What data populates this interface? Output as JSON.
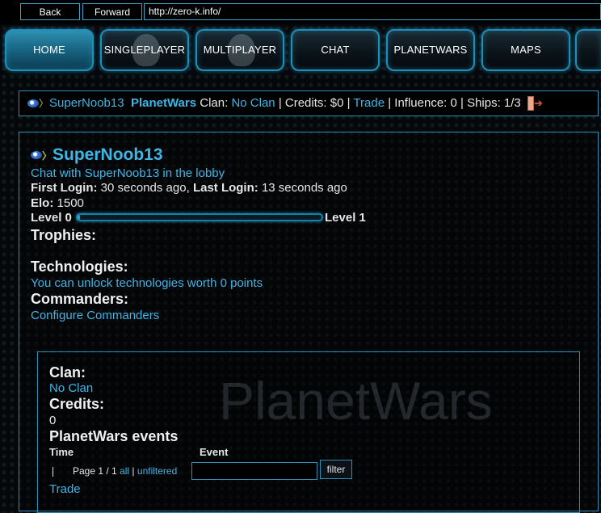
{
  "browser": {
    "back_label": "Back",
    "forward_label": "Forward",
    "url": "http://zero-k.info/"
  },
  "menu": {
    "items": [
      {
        "label": "HOME",
        "active": true
      },
      {
        "label": "SINGLEPLAYER",
        "icon": "single-player-silhouette-icon"
      },
      {
        "label": "MULTIPLAYER",
        "icon": "multi-player-silhouette-icon"
      },
      {
        "label": "CHAT"
      },
      {
        "label": "PLANETWARS"
      },
      {
        "label": "MAPS"
      }
    ]
  },
  "userbar": {
    "username": "SuperNoob13",
    "planetwars_label": "PlanetWars",
    "clan_label": "Clan:",
    "clan_value": "No Clan",
    "credits_text": "| Credits: $0 |",
    "trade_label": "Trade",
    "influence_ships_text": "| Influence: 0 | Ships: 1/3",
    "logout_icon": "logout-icon"
  },
  "profile": {
    "name": "SuperNoob13",
    "chat_link": "Chat with SuperNoob13 in the lobby",
    "first_login_label": "First Login:",
    "first_login_value": "30 seconds ago,",
    "last_login_label": "Last Login:",
    "last_login_value": "13 seconds ago",
    "elo_label": "Elo:",
    "elo_value": "1500",
    "level_from": "Level 0",
    "level_to": "Level 1",
    "level_progress": 0.01,
    "trophies_heading": "Trophies:",
    "technologies_heading": "Technologies:",
    "technologies_link": "You can unlock technologies worth 0 points",
    "commanders_heading": "Commanders:",
    "commanders_link": "Configure Commanders"
  },
  "planetwars_box": {
    "watermark": "PlanetWars",
    "clan_heading": "Clan:",
    "clan_value": "No Clan",
    "credits_heading": "Credits:",
    "credits_value": "0",
    "events_heading": "PlanetWars events",
    "col_time": "Time",
    "col_event": "Event",
    "page_text": "Page 1 / 1",
    "all_link": "all",
    "separator": "|",
    "unfiltered_link": "unfiltered",
    "filter_button": "filter",
    "trade_link": "Trade"
  },
  "colors": {
    "accent": "#3fb6e8",
    "border": "#2d8fb6",
    "background": "#05080b"
  }
}
